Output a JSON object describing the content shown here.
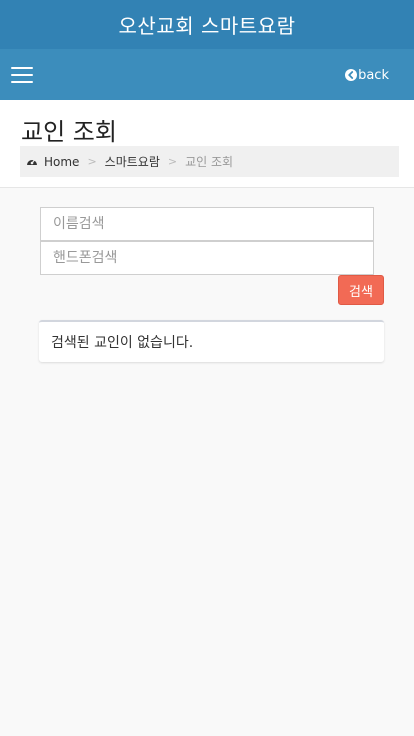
{
  "app": {
    "title": "오산교회 스마트요람"
  },
  "navbar": {
    "back_label": "back"
  },
  "page": {
    "title": "교인 조회"
  },
  "breadcrumb": {
    "home": "Home",
    "section": "스마트요람",
    "current": "교인 조회"
  },
  "search": {
    "name_placeholder": "이름검색",
    "name_value": "",
    "phone_placeholder": "핸드폰검색",
    "phone_value": "",
    "button_label": "검색"
  },
  "results": {
    "empty_message": "검색된 교인이 없습니다."
  },
  "colors": {
    "topbar": "#3282b4",
    "navbar": "#3c8dbc",
    "search_button": "#f26a55",
    "background": "#f9f9f9"
  },
  "icons": {
    "menu": "hamburger-icon",
    "back": "arrow-circle-left-icon",
    "home": "dashboard-icon"
  }
}
